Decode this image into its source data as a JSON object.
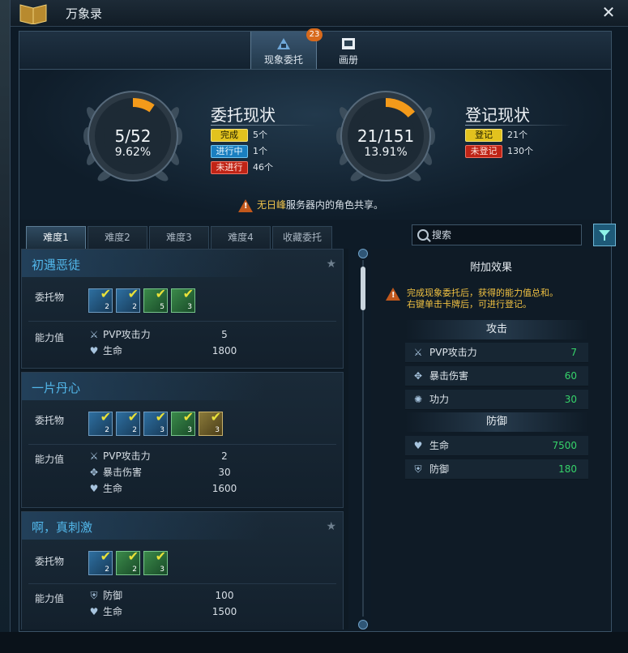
{
  "window": {
    "title": "万象录"
  },
  "top_tabs": [
    {
      "label": "现象委托",
      "active": true,
      "badge": "23"
    },
    {
      "label": "画册",
      "active": false
    }
  ],
  "commission": {
    "count": "5/52",
    "percent": "9.62%",
    "fraction": 0.0962,
    "title": "委托现状",
    "rows": [
      {
        "tag": "完成",
        "value": "5个",
        "color": "yellow"
      },
      {
        "tag": "进行中",
        "value": "1个",
        "color": "blue"
      },
      {
        "tag": "未进行",
        "value": "46个",
        "color": "red"
      }
    ]
  },
  "registry": {
    "count": "21/151",
    "percent": "13.91%",
    "fraction": 0.1391,
    "title": "登记现状",
    "rows": [
      {
        "tag": "登记",
        "value": "21个",
        "color": "yellow"
      },
      {
        "tag": "未登记",
        "value": "130个",
        "color": "red"
      }
    ]
  },
  "notice": {
    "highlight": "无日峰",
    "text": "服务器内的角色共享。"
  },
  "difficulty_tabs": [
    "难度1",
    "难度2",
    "难度3",
    "难度4",
    "收藏委托"
  ],
  "search": {
    "placeholder": "搜索"
  },
  "labels": {
    "cards": "委托物",
    "stats": "能力值"
  },
  "cards": [
    {
      "title": "初遇恶徒",
      "card_count": 4,
      "card_numbers": [
        "2",
        "2",
        "5",
        "3"
      ],
      "stats": [
        {
          "icon": "pvp-attack-icon",
          "label": "PVP攻击力",
          "value": "5"
        },
        {
          "icon": "heart-icon",
          "label": "生命",
          "value": "1800"
        }
      ]
    },
    {
      "title": "一片丹心",
      "card_count": 5,
      "card_numbers": [
        "2",
        "2",
        "3",
        "3",
        "3"
      ],
      "stats": [
        {
          "icon": "pvp-attack-icon",
          "label": "PVP攻击力",
          "value": "2"
        },
        {
          "icon": "crit-damage-icon",
          "label": "暴击伤害",
          "value": "30"
        },
        {
          "icon": "heart-icon",
          "label": "生命",
          "value": "1600"
        }
      ]
    },
    {
      "title": "啊，真刺激",
      "card_count": 3,
      "card_numbers": [
        "2",
        "2",
        "3"
      ],
      "stats": [
        {
          "icon": "shield-icon",
          "label": "防御",
          "value": "100"
        },
        {
          "icon": "heart-icon",
          "label": "生命",
          "value": "1500"
        }
      ]
    }
  ],
  "effects": {
    "title": "附加效果",
    "note_line1": "完成现象委托后，获得的能力值总和。",
    "note_line2": "右键单击卡牌后，可进行登记。",
    "attack_section": "攻击",
    "attack": [
      {
        "icon": "pvp-attack-icon",
        "label": "PVP攻击力",
        "value": "7"
      },
      {
        "icon": "crit-damage-icon",
        "label": "暴击伤害",
        "value": "60"
      },
      {
        "icon": "power-icon",
        "label": "功力",
        "value": "30"
      }
    ],
    "defense_section": "防御",
    "defense": [
      {
        "icon": "heart-icon",
        "label": "生命",
        "value": "7500"
      },
      {
        "icon": "shield-icon",
        "label": "防御",
        "value": "180"
      }
    ]
  },
  "colors": {
    "accent": "#f39a1a",
    "title_blue": "#52b7ea",
    "value_green": "#36d36a"
  }
}
